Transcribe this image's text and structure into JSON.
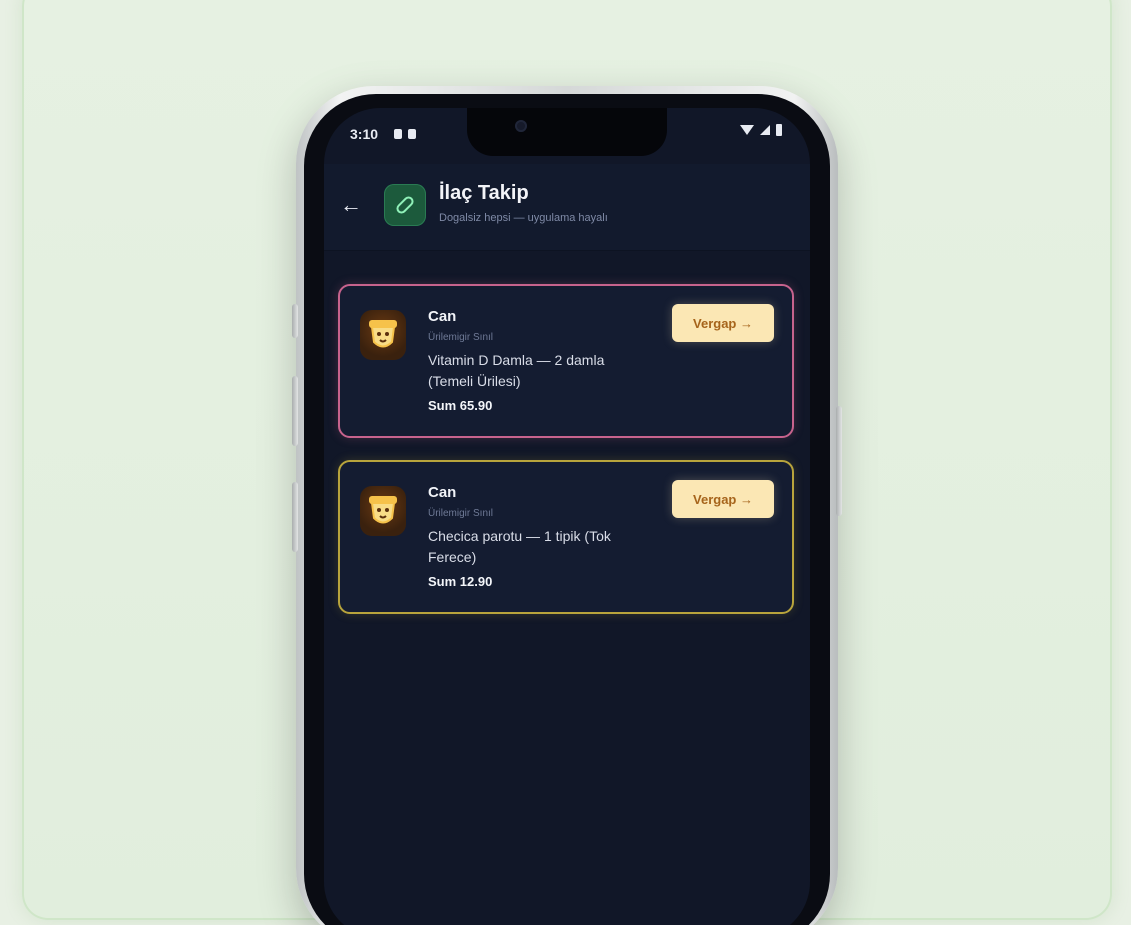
{
  "status_bar": {
    "time": "3:10"
  },
  "app_bar": {
    "back_icon": "arrow-left-icon",
    "app_icon": "pill-icon",
    "title": "İlaç Takip",
    "subtitle": "Dogalsiz hepsi — uygulama hayalı"
  },
  "cards": [
    {
      "name": "Can",
      "subtitle": "Ürilemigir Sınıl",
      "detail": "Vitamin D Damla — 2 damla (Temeli Ürilesi)",
      "price": "Sum 65.90",
      "action_label": "Vergap →",
      "accent": "#c7638d",
      "badge_icon": "lion-icon"
    },
    {
      "name": "Can",
      "subtitle": "Ürilemigir Sınıl",
      "detail": "Checica parotu — 1 tipik (Tok Ferece)",
      "price": "Sum 12.90",
      "action_label": "Vergap →",
      "accent": "#b8a43c",
      "badge_icon": "lion-icon"
    }
  ],
  "colors": {
    "background": "#e8f0e4",
    "screen": "#111728",
    "button": "#fbe7b4"
  }
}
